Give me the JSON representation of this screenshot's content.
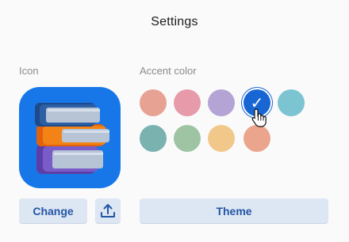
{
  "dialog": {
    "title": "Settings"
  },
  "icon_section": {
    "label": "Icon",
    "icon_name": "books-icon",
    "change_label": "Change",
    "upload_icon": "upload-icon"
  },
  "accent_section": {
    "label": "Accent color",
    "swatches": [
      {
        "color": "#e8a294",
        "selected": false
      },
      {
        "color": "#e69aaa",
        "selected": false
      },
      {
        "color": "#b4a4d6",
        "selected": false
      },
      {
        "color": "#1766d4",
        "selected": true
      },
      {
        "color": "#7cc4d2",
        "selected": false
      },
      {
        "color": "#7ab2b0",
        "selected": false
      },
      {
        "color": "#9ec4a4",
        "selected": false
      },
      {
        "color": "#f1c88a",
        "selected": false
      },
      {
        "color": "#eaa58c",
        "selected": false
      }
    ],
    "theme_label": "Theme"
  },
  "colors": {
    "button_bg": "#dde6f3",
    "button_text": "#2456a5",
    "icon_tile": "#1877e8"
  }
}
